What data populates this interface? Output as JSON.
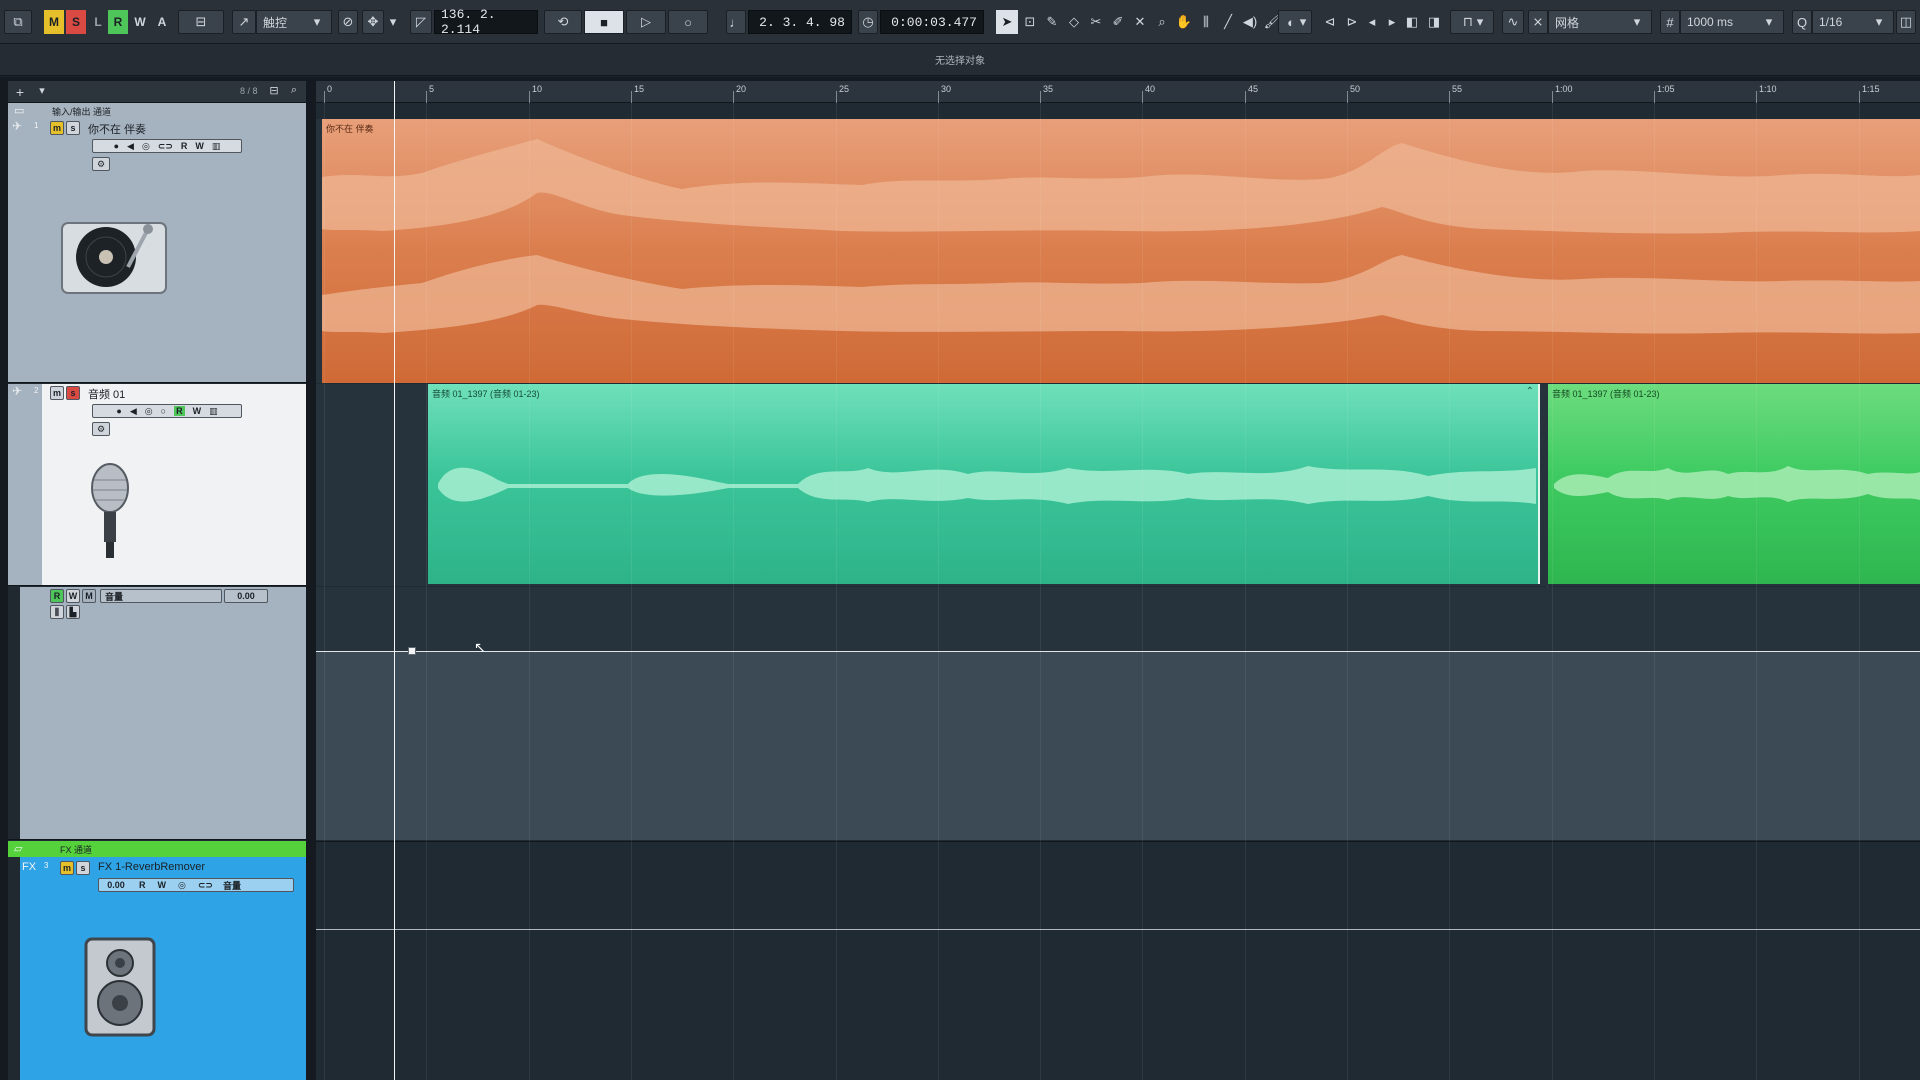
{
  "toolbar": {
    "mode_letters": [
      "M",
      "S",
      "L",
      "R",
      "W",
      "A"
    ],
    "automation_mode": "触控",
    "position_left": "136. 2. 2.114",
    "position_right": "2. 3. 4. 98",
    "time_display": "0:00:03.477",
    "snap_type": "网格",
    "nudge_value": "1000 ms",
    "quantize_value": "1/16"
  },
  "info_line": "无选择对象",
  "tracklist": {
    "count": "8 / 8",
    "folder_label": "输入/输出 通道",
    "fx_folder_label": "FX 通道",
    "tracks": [
      {
        "number": "1",
        "name": "你不在 伴奏",
        "icon": "turntable-icon"
      },
      {
        "number": "2",
        "name": "音频 01",
        "icon": "microphone-icon"
      },
      {
        "number": "3",
        "name": "FX 1-ReverbRemover",
        "icon": "speaker-icon",
        "prefix": "FX",
        "value": "0.00"
      }
    ],
    "automation": {
      "param": "音量",
      "value": "0.00"
    }
  },
  "ruler": {
    "ticks": [
      "0",
      "5",
      "10",
      "15",
      "20",
      "25",
      "30",
      "35",
      "40",
      "45",
      "50",
      "55",
      "1:00",
      "1:05",
      "1:10",
      "1:15"
    ]
  },
  "events": [
    {
      "label": "你不在 伴奏"
    },
    {
      "label": "音频 01_1397 (音频 01-23)"
    },
    {
      "label": "音频 01_1397 (音频 01-23)"
    }
  ],
  "colors": {
    "orange_event": "#e28a5a",
    "teal_event": "#3cc59a",
    "green_event": "#3fcb62",
    "fx_track": "#2ea3e6",
    "fx_folder": "#55d13b"
  }
}
